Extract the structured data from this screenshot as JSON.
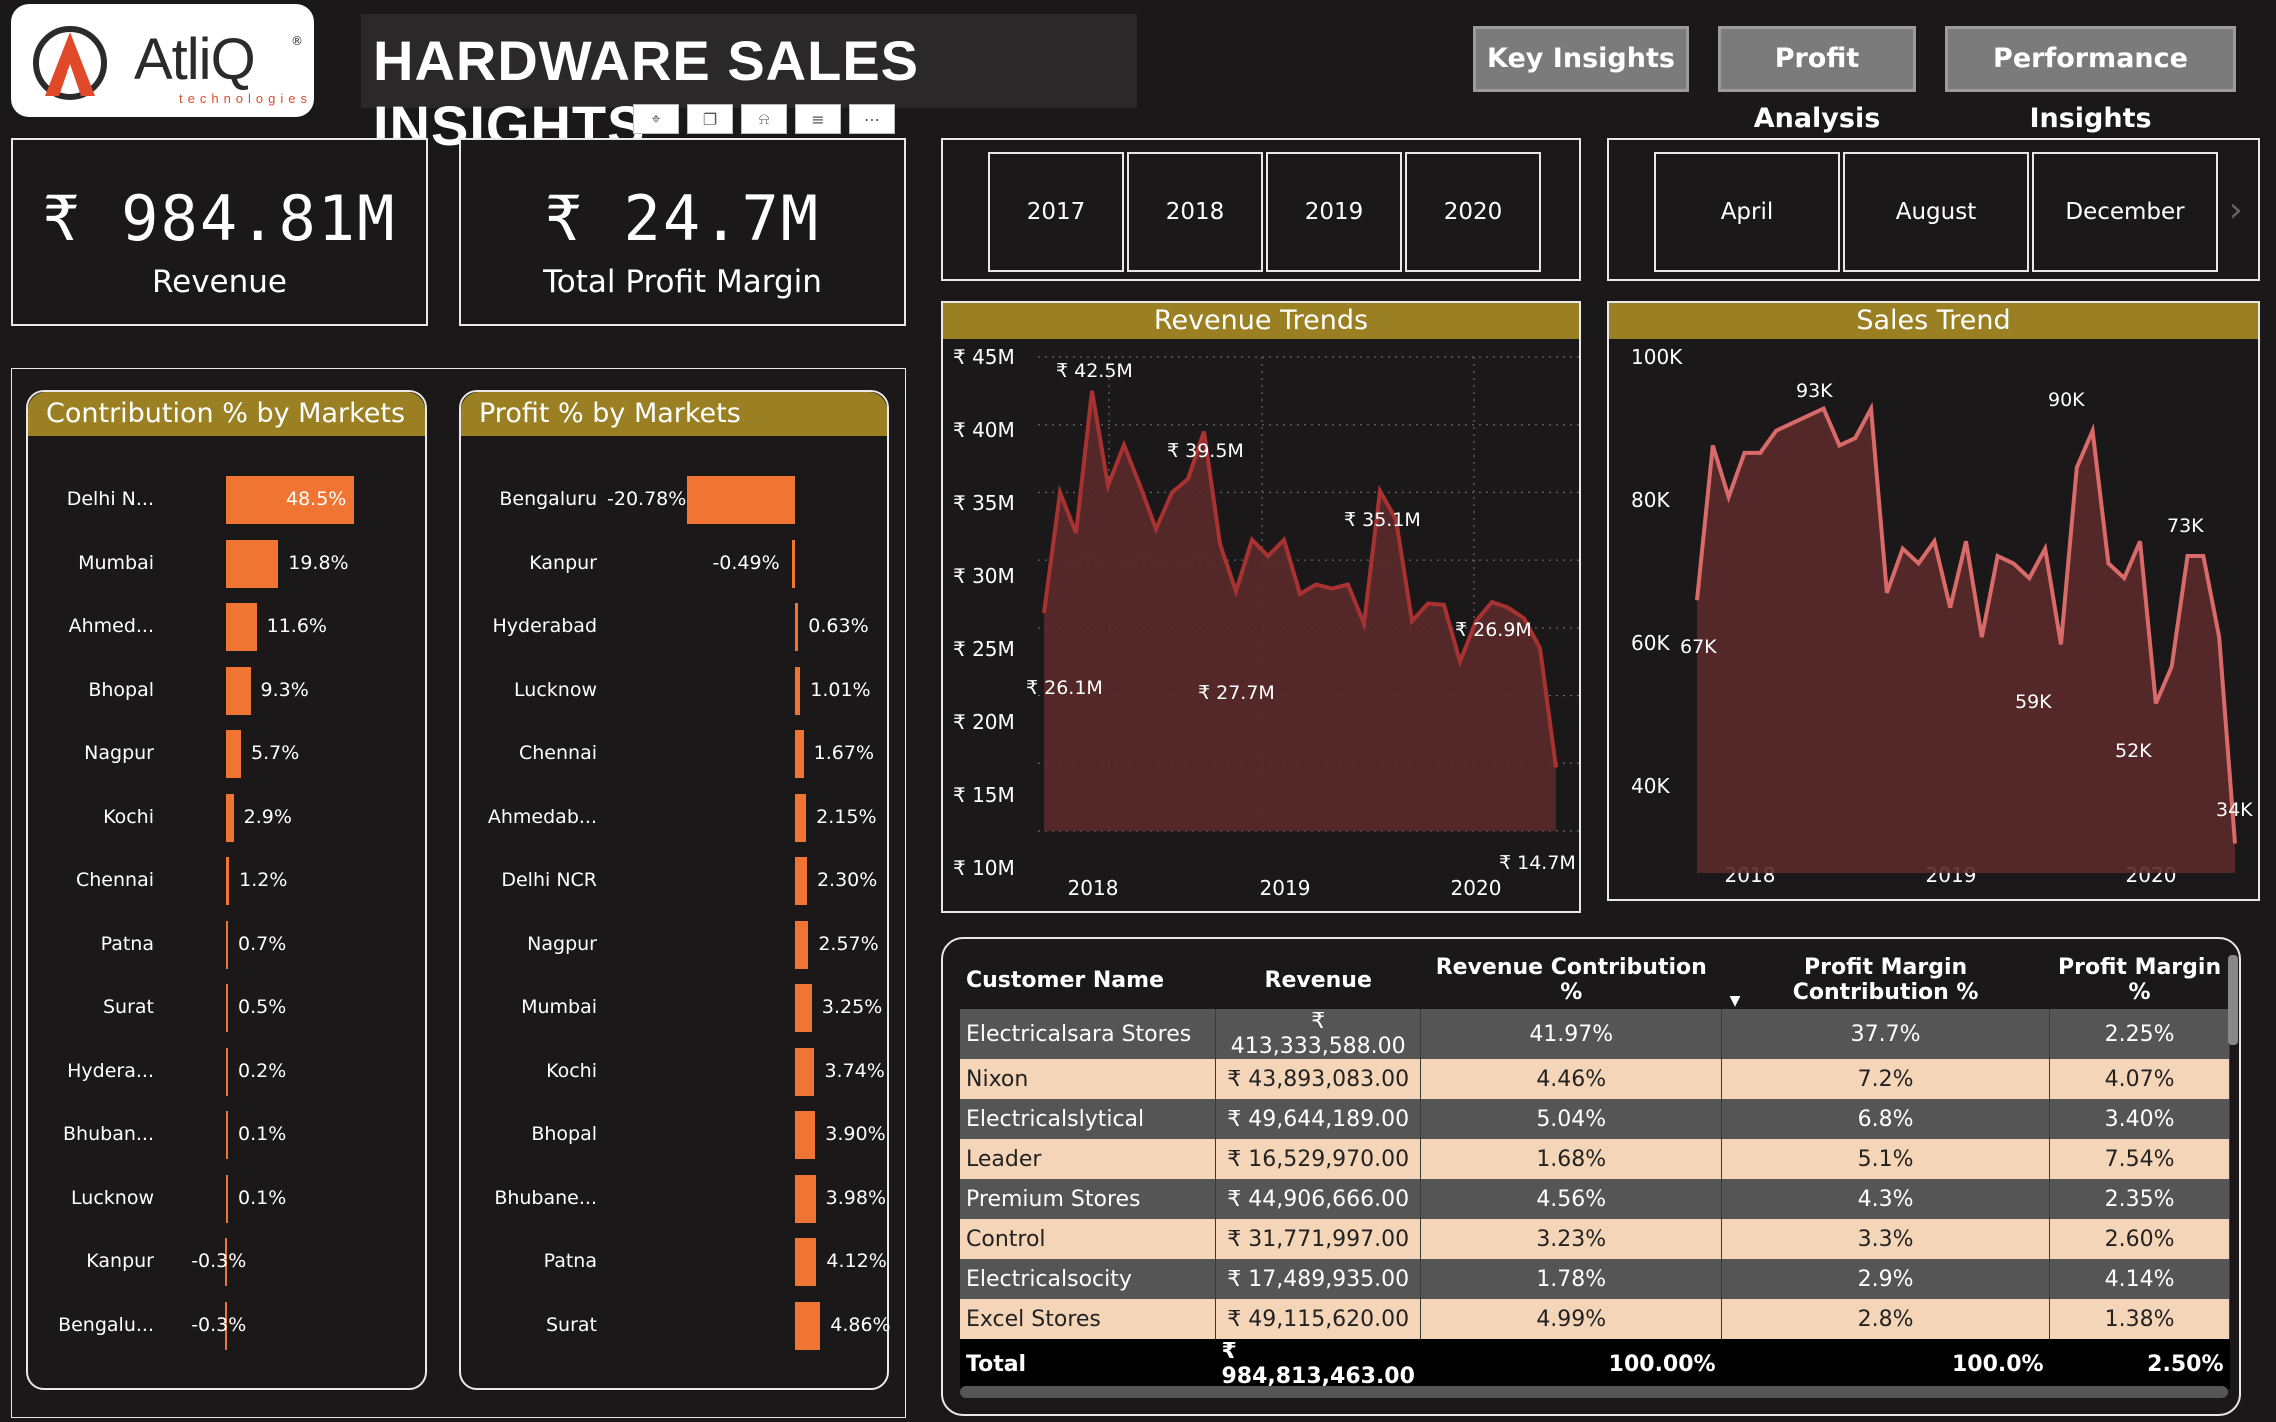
{
  "header": {
    "logo_name": "AtliQ",
    "logo_sub": "technologies",
    "title": "HARDWARE SALES INSIGHTS",
    "nav": [
      "Key Insights",
      "Profit Analysis",
      "Performance Insights"
    ],
    "toolbar_icons": [
      "pin-icon",
      "copy-icon",
      "bell-icon",
      "filter-icon",
      "more-icon"
    ]
  },
  "kpis": {
    "revenue_value": "₹ 984.81M",
    "revenue_label": "Revenue",
    "profit_value": "₹ 24.7M",
    "profit_label": "Total Profit Margin"
  },
  "years": [
    "2017",
    "2018",
    "2019",
    "2020"
  ],
  "months": [
    "April",
    "August",
    "December"
  ],
  "colors": {
    "accent": "#9b8023",
    "bar": "#f07533",
    "line": "#d96a6a",
    "area": "#5b2a2a"
  },
  "chart_data": [
    {
      "type": "bar",
      "title": "Contribution % by Markets",
      "categories": [
        "Delhi N...",
        "Mumbai",
        "Ahmed...",
        "Bhopal",
        "Nagpur",
        "Kochi",
        "Chennai",
        "Patna",
        "Surat",
        "Hydera...",
        "Bhuban...",
        "Lucknow",
        "Kanpur",
        "Bengalu..."
      ],
      "values": [
        48.5,
        19.8,
        11.6,
        9.3,
        5.7,
        2.9,
        1.2,
        0.7,
        0.5,
        0.2,
        0.1,
        0.1,
        -0.3,
        -0.3
      ],
      "labels": [
        "48.5%",
        "19.8%",
        "11.6%",
        "9.3%",
        "5.7%",
        "2.9%",
        "1.2%",
        "0.7%",
        "0.5%",
        "0.2%",
        "0.1%",
        "0.1%",
        "-0.3%",
        "-0.3%"
      ]
    },
    {
      "type": "bar",
      "title": "Profit % by Markets",
      "categories": [
        "Bengaluru",
        "Kanpur",
        "Hyderabad",
        "Lucknow",
        "Chennai",
        "Ahmedab...",
        "Delhi NCR",
        "Nagpur",
        "Mumbai",
        "Kochi",
        "Bhopal",
        "Bhubane...",
        "Patna",
        "Surat"
      ],
      "values": [
        -20.78,
        -0.49,
        0.63,
        1.01,
        1.67,
        2.15,
        2.3,
        2.57,
        3.25,
        3.74,
        3.9,
        3.98,
        4.12,
        4.86
      ],
      "labels": [
        "-20.78%",
        "-0.49%",
        "0.63%",
        "1.01%",
        "1.67%",
        "2.15%",
        "2.30%",
        "2.57%",
        "3.25%",
        "3.74%",
        "3.90%",
        "3.98%",
        "4.12%",
        "4.86%"
      ]
    },
    {
      "type": "area",
      "title": "Revenue Trends",
      "x": [
        2017.75,
        2017.83,
        2017.92,
        2018.0,
        2018.08,
        2018.17,
        2018.25,
        2018.33,
        2018.42,
        2018.5,
        2018.58,
        2018.67,
        2018.75,
        2018.83,
        2018.92,
        2019.0,
        2019.08,
        2019.17,
        2019.25,
        2019.33,
        2019.42,
        2019.5,
        2019.58,
        2019.67,
        2019.75,
        2019.83,
        2019.92,
        2020.0,
        2020.08,
        2020.17,
        2020.25,
        2020.33,
        2020.42
      ],
      "values": [
        26.1,
        35.0,
        32.0,
        42.5,
        35.5,
        38.5,
        35.5,
        32.3,
        35.0,
        36.0,
        39.5,
        31.2,
        27.7,
        31.5,
        30.3,
        31.5,
        27.5,
        28.2,
        27.9,
        28.2,
        25.3,
        35.1,
        33.0,
        25.5,
        26.8,
        26.7,
        22.5,
        25.5,
        26.9,
        26.5,
        25.7,
        23.5,
        14.7
      ],
      "ylim": [
        10,
        45
      ],
      "yticks": [
        "₹ 45M",
        "₹ 40M",
        "₹ 35M",
        "₹ 30M",
        "₹ 25M",
        "₹ 20M",
        "₹ 15M",
        "₹ 10M"
      ],
      "xticks": [
        "2018",
        "2019",
        "2020"
      ],
      "annotations": [
        "₹ 42.5M",
        "₹ 39.5M",
        "₹ 35.1M",
        "₹ 27.7M",
        "₹ 26.9M",
        "₹ 26.1M",
        "₹ 14.7M"
      ]
    },
    {
      "type": "area",
      "title": "Sales Trend",
      "x": [
        2017.75,
        2017.83,
        2017.92,
        2018.0,
        2018.08,
        2018.17,
        2018.25,
        2018.33,
        2018.42,
        2018.5,
        2018.58,
        2018.67,
        2018.75,
        2018.83,
        2018.92,
        2019.0,
        2019.08,
        2019.17,
        2019.25,
        2019.33,
        2019.42,
        2019.5,
        2019.58,
        2019.67,
        2019.75,
        2019.83,
        2019.92,
        2020.0,
        2020.08,
        2020.17,
        2020.25,
        2020.33,
        2020.42
      ],
      "values": [
        67,
        88,
        81,
        87,
        87,
        90,
        91,
        92,
        93,
        88,
        89,
        93,
        68,
        74,
        72,
        75,
        66,
        75,
        62,
        73,
        72,
        70,
        74,
        61,
        85,
        90,
        72,
        70,
        75,
        53,
        58,
        73,
        73,
        62,
        34
      ],
      "ylim": [
        30,
        100
      ],
      "yticks": [
        "100K",
        "80K",
        "60K",
        "40K"
      ],
      "xticks": [
        "2018",
        "2019",
        "2020"
      ],
      "annotations": [
        "93K",
        "90K",
        "73K",
        "67K",
        "59K",
        "52K",
        "34K"
      ]
    }
  ],
  "table": {
    "columns": [
      "Customer Name",
      "Revenue",
      "Revenue Contribution %",
      "Profit Margin Contribution %",
      "Profit Margin %"
    ],
    "rows": [
      [
        "Electricalsara Stores",
        "₹ 413,333,588.00",
        "41.97%",
        "37.7%",
        "2.25%"
      ],
      [
        "Nixon",
        "₹ 43,893,083.00",
        "4.46%",
        "7.2%",
        "4.07%"
      ],
      [
        "Electricalslytical",
        "₹ 49,644,189.00",
        "5.04%",
        "6.8%",
        "3.40%"
      ],
      [
        "Leader",
        "₹ 16,529,970.00",
        "1.68%",
        "5.1%",
        "7.54%"
      ],
      [
        "Premium Stores",
        "₹ 44,906,666.00",
        "4.56%",
        "4.3%",
        "2.35%"
      ],
      [
        "Control",
        "₹ 31,771,997.00",
        "3.23%",
        "3.3%",
        "2.60%"
      ],
      [
        "Electricalsocity",
        "₹ 17,489,935.00",
        "1.78%",
        "2.9%",
        "4.14%"
      ],
      [
        "Excel Stores",
        "₹ 49,115,620.00",
        "4.99%",
        "2.8%",
        "1.38%"
      ]
    ],
    "total": [
      "Total",
      "₹ 984,813,463.00",
      "100.00%",
      "100.0%",
      "2.50%"
    ]
  }
}
